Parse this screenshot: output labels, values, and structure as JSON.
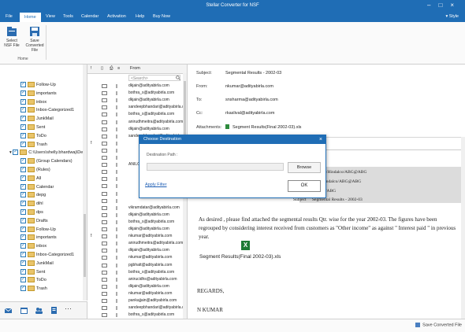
{
  "window": {
    "title": "Stellar Converter for NSF"
  },
  "menu": {
    "items": [
      "File",
      "Home",
      "View",
      "Tools",
      "Calendar",
      "Activation",
      "Help",
      "Buy Now"
    ],
    "active": "Home",
    "style_label": "Style"
  },
  "ribbon": {
    "select_label": "Select\nNSF File",
    "save_label": "Save\nConverted File",
    "group_label": "Home"
  },
  "tree": {
    "items": [
      {
        "label": "Follow-Up",
        "kind": "cb",
        "indent": 1
      },
      {
        "label": "importants",
        "kind": "cb",
        "indent": 1
      },
      {
        "label": "inbox",
        "kind": "cb",
        "indent": 1
      },
      {
        "label": "Inbox-Categorized1",
        "kind": "cb",
        "indent": 1
      },
      {
        "label": "JunkMail",
        "kind": "cb",
        "indent": 1
      },
      {
        "label": "Sent",
        "kind": "cb",
        "indent": 1
      },
      {
        "label": "ToDo",
        "kind": "cb",
        "indent": 1
      },
      {
        "label": "Trash",
        "kind": "cb",
        "indent": 1
      },
      {
        "label": "C:\\Users\\shelly.bhardwaj\\De",
        "kind": "root",
        "indent": 0
      },
      {
        "label": "(Group Calendars)",
        "kind": "cb",
        "indent": 1
      },
      {
        "label": "(Rules)",
        "kind": "cb",
        "indent": 1
      },
      {
        "label": "All",
        "kind": "cb",
        "indent": 1
      },
      {
        "label": "Calendar",
        "kind": "cb",
        "indent": 1
      },
      {
        "label": "depg",
        "kind": "cb",
        "indent": 1
      },
      {
        "label": "dihl",
        "kind": "cb",
        "indent": 1
      },
      {
        "label": "dps",
        "kind": "cb",
        "indent": 1
      },
      {
        "label": "Drafts",
        "kind": "cb",
        "indent": 1
      },
      {
        "label": "Follow-Up",
        "kind": "cb",
        "indent": 1
      },
      {
        "label": "importants",
        "kind": "cb",
        "indent": 1
      },
      {
        "label": "inbox",
        "kind": "cb",
        "indent": 1
      },
      {
        "label": "Inbox-Categorized1",
        "kind": "cb",
        "indent": 1
      },
      {
        "label": "JunkMail",
        "kind": "cb",
        "indent": 1
      },
      {
        "label": "Sent",
        "kind": "cb",
        "indent": 1
      },
      {
        "label": "ToDo",
        "kind": "cb",
        "indent": 1
      },
      {
        "label": "Trash",
        "kind": "cb",
        "indent": 1
      }
    ]
  },
  "list": {
    "headers": {
      "flag": "!",
      "from": "From"
    },
    "search_placeholder": "<Search>",
    "rows": [
      {
        "flag": "",
        "from": "dkjain@adityabirla.com"
      },
      {
        "flag": "",
        "from": "bothra_s@adityabirla.com"
      },
      {
        "flag": "",
        "from": "dkjain@adityabirla.com"
      },
      {
        "flag": "",
        "from": "sandeepbhandari@adityabirla.com"
      },
      {
        "flag": "",
        "from": "bothra_s@adityabirla.com"
      },
      {
        "flag": "",
        "from": "anirudhmeitra@adityabirla.com"
      },
      {
        "flag": "",
        "from": "dkjain@adityabirla.com"
      },
      {
        "flag": "",
        "from": "sandeepbhandari@adityabirla.com"
      },
      {
        "flag": "!",
        "from": ""
      },
      {
        "flag": "",
        "from": ""
      },
      {
        "flag": "",
        "from": ""
      },
      {
        "flag": "",
        "from": "ANILC"
      },
      {
        "flag": "",
        "from": ""
      },
      {
        "flag": "",
        "from": ""
      },
      {
        "flag": "",
        "from": ""
      },
      {
        "flag": "",
        "from": ""
      },
      {
        "flag": "",
        "from": ""
      },
      {
        "flag": "",
        "from": "vikramdatar@adityabirla.com"
      },
      {
        "flag": "",
        "from": "dkjain@adityabirla.com"
      },
      {
        "flag": "",
        "from": "bothra_s@adityabirla.com"
      },
      {
        "flag": "",
        "from": "dkjain@adityabirla.com"
      },
      {
        "flag": "!",
        "from": "nkumar@adityabirla.com"
      },
      {
        "flag": "",
        "from": "anirudhmeitra@adityabirla.com"
      },
      {
        "flag": "",
        "from": "dkjain@adityabirla.com"
      },
      {
        "flag": "",
        "from": "nkumar@adityabirla.com"
      },
      {
        "flag": "",
        "from": "pgbhatt@adityabirla.com"
      },
      {
        "flag": "",
        "from": "bothra_s@adityabirla.com"
      },
      {
        "flag": "",
        "from": "anirucidhs@adityabirla.com"
      },
      {
        "flag": "",
        "from": "dkjain@adityabirla.com"
      },
      {
        "flag": "",
        "from": "nkumar@adityabirla.com"
      },
      {
        "flag": "",
        "from": "pankajjain@adityabirla.com"
      },
      {
        "flag": "",
        "from": "sandeepbhandari@adityabirla.com"
      },
      {
        "flag": "",
        "from": "bothra_s@adityabirla.com"
      },
      {
        "flag": "",
        "from": "sandeepbhandari@adityabirla.com"
      }
    ]
  },
  "preview": {
    "subject_label": "Subject:",
    "subject": "Segmental Results - 2002-03",
    "from_label": "From:",
    "from": "nkumar@adityabirla.com",
    "to_label": "To:",
    "to": "snsharma@adityabirla.com",
    "cc_label": "Cc:",
    "cc": "rkaslival@adityabirla.com",
    "attachments_label": "Attachments:",
    "attachment": "Segment Results(Final 2002-03).xls",
    "block_line1": "rma/FINANCE/Hindalco/ABG@ABG",
    "block_line2": "llival/ ADM/Hindalco/ABG@ABG",
    "block_line3": "/I/FIN/DIS/BC/ABG",
    "block_subject_label": "Subject",
    "block_subject": "Segmental Results - 2002-03",
    "body": "As desired , please find attached the segmental results Qtr. wise for the year 2002-03. The figures have been regrouped by considering interest received from customers as \"Other income\" as against \" Interest paid \" in previous year.",
    "xls_caption": "Segment Results(Final 2002-03).xls",
    "regards": "REGARDS,",
    "signer": "N KUMAR"
  },
  "status": {
    "save_label": "Save Converted File"
  },
  "dialog": {
    "title": "Choose Destination",
    "close_label": "×",
    "path_label": "Destination Path :",
    "browse_label": "Browse",
    "ok_label": "OK",
    "filter_label": "Apply Filter"
  }
}
